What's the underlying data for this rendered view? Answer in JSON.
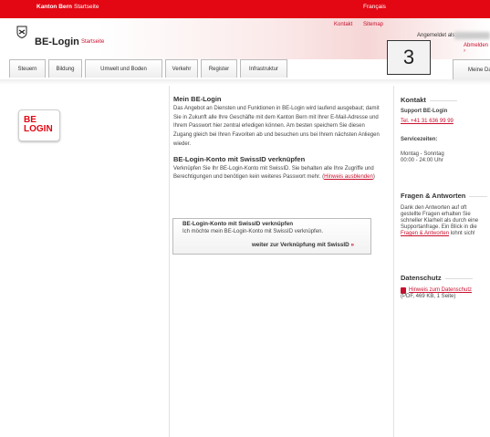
{
  "topbar": {
    "kanton_bern": "Kanton Bern",
    "startseite": "Startseite",
    "francais": "Français"
  },
  "header": {
    "app_title": "BE-Login",
    "startseite": "Startseite",
    "kontakt": "Kontakt",
    "sitemap": "Sitemap",
    "angemeldet_als": "Angemeldet als:",
    "abmelden": "Abmelden ›"
  },
  "badge": {
    "number": "3"
  },
  "tabs": [
    {
      "label": "Steuern"
    },
    {
      "label": "Bildung"
    },
    {
      "label": "Umwelt und Boden"
    },
    {
      "label": "Verkehr"
    },
    {
      "label": "Register"
    },
    {
      "label": "Infrastruktur"
    }
  ],
  "meine_daten": "Meine Date",
  "logo": {
    "line1": "BE",
    "line2": "LOGIN"
  },
  "main": {
    "title": "Mein BE-Login",
    "intro": "Das Angebot an Diensten und Funktionen in BE-Login wird laufend ausgebaut; damit Sie in Zukunft alle Ihre Geschäfte mit dem Kanton Bern mit Ihrer E-Mail-Adresse und Ihrem Passwort hier zentral erledigen können. Am besten speichern Sie diesen Zugang gleich bei Ihren Favoriten ab und besuchen uns bei Ihrem nächsten Anliegen wieder.",
    "swiss_title": "BE-Login-Konto mit SwissID verknüpfen",
    "swiss_text": "Verknüpfen Sie Ihr BE-Login-Konto mit SwissID. Sie behalten alle Ihre Zugriffe und Berechtigungen und benötigen kein weiteres Passwort mehr.",
    "hint_link": "Hinweis ausblenden",
    "box_title": "BE-Login-Konto mit SwissID verknüpfen",
    "box_text": "Ich möchte mein BE-Login-Konto mit SwissID verknüpfen.",
    "box_link": "weiter zur Verknüpfung mit SwissID",
    "box_arrow": "»"
  },
  "sidebar": {
    "kontakt_title": "Kontakt",
    "support": "Support BE-Login",
    "phone": "Tel. +41 31 636 99 99",
    "servicezeiten": "Servicezeiten:",
    "days": "Montag - Sonntag",
    "hours": "00:00 - 24:00 Uhr",
    "faq_title": "Fragen & Antworten",
    "faq_text1": "Dank den Antworten auf oft",
    "faq_text2": "gestellte Fragen erhalten Sie",
    "faq_text3": "schneller Klarheit als durch eine",
    "faq_text4": "Supportanfrage. Ein Blick in die",
    "faq_link": "Fragen & Antworten",
    "faq_text5": " lohnt sich!",
    "datenschutz_title": "Datenschutz",
    "datenschutz_link": "Hinweis zum Datenschutz",
    "datenschutz_meta": "(PDF, 469 KB, 1 Seite)"
  }
}
